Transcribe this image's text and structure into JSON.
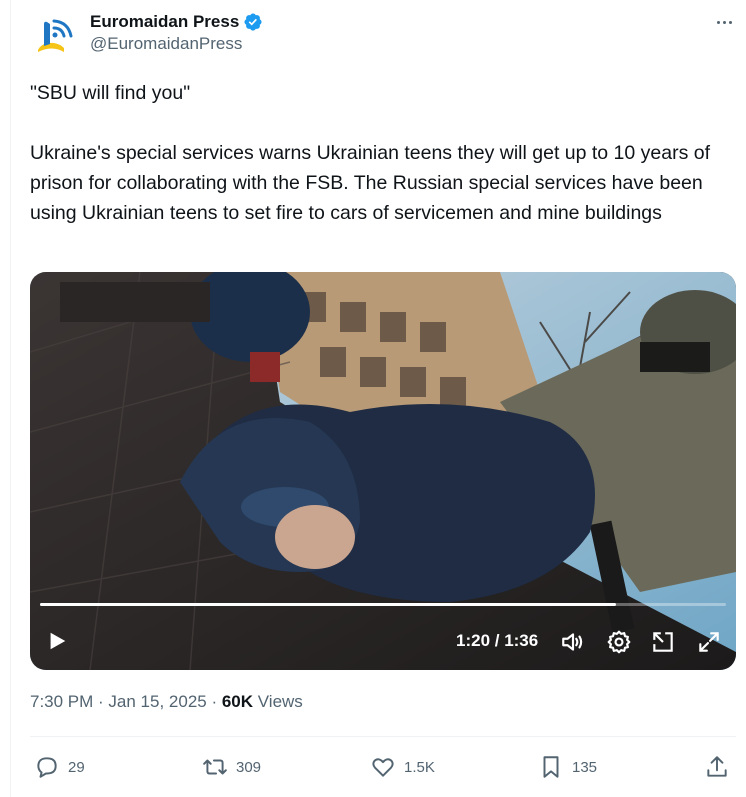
{
  "author": {
    "display_name": "Euromaidan Press",
    "handle": "@EuromaidanPress",
    "verified": true,
    "verified_color": "#1d9bf0",
    "avatar_icon": "euromaidan-logo-icon"
  },
  "tweet": {
    "quote": "\"SBU will find you\"",
    "body": "Ukraine's special services warns Ukrainian teens they will get up to 10 years of prison for collaborating with the FSB. The Russian special services have been using Ukrainian teens to set fire to cars of servicemen and mine buildings"
  },
  "video": {
    "time_display": "1:20 / 1:36",
    "progress": 0.84,
    "controls": [
      "play-icon",
      "volume-icon",
      "settings-icon",
      "picture-in-picture-icon",
      "fullscreen-icon"
    ]
  },
  "meta": {
    "time": "7:30 PM",
    "separator": " · ",
    "date": "Jan 15, 2025",
    "views_count": "60K",
    "views_label": " Views"
  },
  "actions": {
    "replies": "29",
    "reposts": "309",
    "likes": "1.5K",
    "bookmarks": "135"
  },
  "colors": {
    "text_primary": "#0f1419",
    "text_secondary": "#536471",
    "accent": "#1d9bf0",
    "logo_blue": "#1f77c4",
    "logo_yellow": "#f6c416"
  }
}
